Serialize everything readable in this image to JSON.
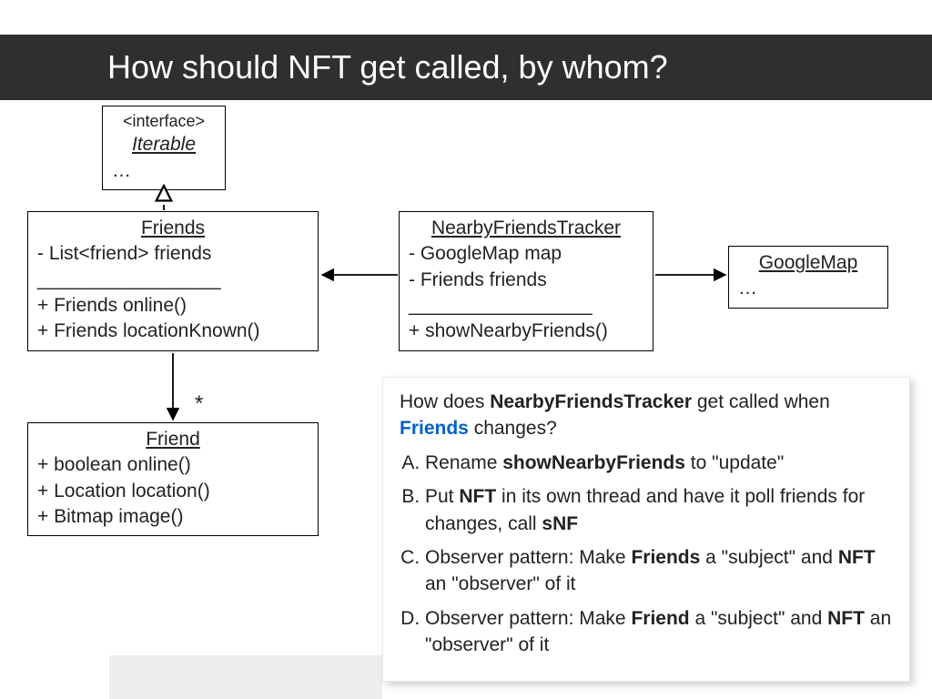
{
  "title": "How should NFT get called, by whom?",
  "iterable": {
    "stereotype": "<interface>",
    "name": "Iterable",
    "rest": "…"
  },
  "friends": {
    "name": "Friends",
    "attr1": "- List<friend> friends",
    "dashes": "__________________",
    "op1": "+ Friends online()",
    "op2": "+ Friends locationKnown()"
  },
  "nft": {
    "name": "NearbyFriendsTracker",
    "attr1": "- GoogleMap map",
    "attr2": "- Friends friends",
    "dashes": "__________________",
    "op1": "+ showNearbyFriends()"
  },
  "gmap": {
    "name": "GoogleMap",
    "rest": "…"
  },
  "friend": {
    "name": "Friend",
    "op1": "+ boolean online()",
    "op2": "+ Location location()",
    "op3": "+ Bitmap image()"
  },
  "star": "*",
  "question": {
    "intro_pre": "How does ",
    "intro_b1": "NearbyFriendsTracker",
    "intro_mid": " get called when ",
    "intro_b2": "Friends",
    "intro_post": " changes?",
    "a_pre": "Rename ",
    "a_b": "showNearbyFriends",
    "a_post": " to \"update\"",
    "b_pre": "Put ",
    "b_b1": "NFT",
    "b_mid": " in its own thread and have it poll friends for changes, call ",
    "b_b2": "sNF",
    "c_pre": "Observer pattern: Make ",
    "c_b1": "Friends",
    "c_mid": " a \"subject\" and ",
    "c_b2": "NFT",
    "c_post": " an \"observer\" of it",
    "d_pre": "Observer pattern: Make ",
    "d_b1": "Friend",
    "d_mid": " a \"subject\" and ",
    "d_b2": "NFT",
    "d_post": " an \"observer\" of it"
  }
}
